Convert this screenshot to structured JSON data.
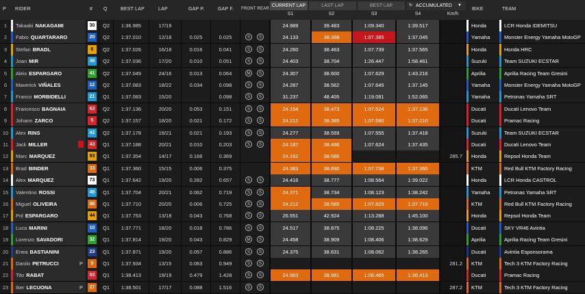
{
  "header": {
    "p": "P",
    "rider": "RIDER",
    "num": "#",
    "q": "Q",
    "best_lap": "BEST LAP",
    "lap": "LAP",
    "gap_p": "GAP P.",
    "gap_f": "GAP F.",
    "tyres": "FRONT REAR",
    "bike": "BIKE",
    "team": "TEAM",
    "speed": "Km/h",
    "tab_current": "CURRENT LAP",
    "tab_last": "LAST LAP",
    "tab_best": "BEST LAP",
    "tab_acc": "ACCUMULATED",
    "s1": "S1",
    "s2": "S2",
    "s3": "S3",
    "s4": "S4"
  },
  "colors": {
    "orange": "#e06a10",
    "red": "#c4161c",
    "gray_sect": "#5a5a5a"
  },
  "rows": [
    {
      "p": "1",
      "rider_first": "Takaaki",
      "rider_last": "NAKAGAMI",
      "num": "30",
      "num_bg": "#ffffff",
      "num_fg": "#000000",
      "q": "Q2",
      "best": "1:36.985",
      "lap": "17/19",
      "gap_p": "",
      "gap_f": "",
      "front": "",
      "rear": "",
      "s1": "24.989",
      "s2": "39.483",
      "s3": "1:09.340",
      "s4": "1:39.517",
      "s1c": "",
      "s2c": "",
      "s3c": "",
      "s4c": "",
      "speed": "",
      "bike": "Honda",
      "team": "LCR Honda IDEMITSU",
      "stripe": "#ffffff",
      "flag": ""
    },
    {
      "p": "2",
      "rider_first": "Fabio",
      "rider_last": "QUARTARARO",
      "num": "20",
      "num_bg": "#1e5fc6",
      "num_fg": "#ffffff",
      "q": "Q2",
      "best": "1:37.010",
      "lap": "12/18",
      "gap_p": "0.025",
      "gap_f": "0.025",
      "front": "S",
      "rear": "S",
      "s1": "24.133",
      "s2": "38.368",
      "s3": "1:07.385",
      "s4": "1:37.045",
      "s1c": "",
      "s2c": "o",
      "s3c": "r",
      "s4c": "",
      "speed": "",
      "bike": "Yamaha",
      "team": "Monster Energy Yamaha MotoGP",
      "stripe": "#1e5fc6",
      "flag": ""
    },
    {
      "p": "3",
      "rider_first": "Stefan",
      "rider_last": "BRADL",
      "num": "6",
      "num_bg": "#e8a200",
      "num_fg": "#000000",
      "q": "Q2",
      "best": "1:37.026",
      "lap": "16/18",
      "gap_p": "0.016",
      "gap_f": "0.041",
      "front": "S",
      "rear": "S",
      "s1": "24.260",
      "s2": "38.463",
      "s3": "1:07.739",
      "s4": "1:37.565",
      "s1c": "",
      "s2c": "",
      "s3c": "",
      "s4c": "",
      "speed": "",
      "bike": "Honda",
      "team": "Honda HRC",
      "stripe": "#e8a200",
      "flag": ""
    },
    {
      "p": "4",
      "rider_first": "Joan",
      "rider_last": "MIR",
      "num": "36",
      "num_bg": "#1f9ad6",
      "num_fg": "#ffffff",
      "q": "Q2",
      "best": "1:37.036",
      "lap": "17/20",
      "gap_p": "0.010",
      "gap_f": "0.051",
      "front": "S",
      "rear": "S",
      "s1": "24.403",
      "s2": "38.704",
      "s3": "1:26.447",
      "s4": "1:58.461",
      "s1c": "",
      "s2c": "",
      "s3c": "",
      "s4c": "",
      "speed": "",
      "bike": "Suzuki",
      "team": "Team SUZUKI ECSTAR",
      "stripe": "#1f9ad6",
      "flag": ""
    },
    {
      "p": "5",
      "rider_first": "Aleix",
      "rider_last": "ESPARGARO",
      "num": "41",
      "num_bg": "#2ca32c",
      "num_fg": "#ffffff",
      "q": "Q2",
      "best": "1:37.049",
      "lap": "24/16",
      "gap_p": "0.013",
      "gap_f": "0.064",
      "front": "M",
      "rear": "S",
      "s1": "24.307",
      "s2": "38.600",
      "s3": "1:07.629",
      "s4": "1:43.216",
      "s1c": "",
      "s2c": "",
      "s3c": "",
      "s4c": "",
      "speed": "",
      "bike": "Aprilia",
      "team": "Aprilia Racing Team Gresini",
      "stripe": "#2ca32c",
      "flag": ""
    },
    {
      "p": "6",
      "rider_first": "Maverick",
      "rider_last": "VIÑALES",
      "num": "12",
      "num_bg": "#1e5fc6",
      "num_fg": "#ffffff",
      "q": "Q2",
      "best": "1:37.083",
      "lap": "18/22",
      "gap_p": "0.034",
      "gap_f": "0.098",
      "front": "S",
      "rear": "S",
      "s1": "24.287",
      "s2": "38.562",
      "s3": "1:07.645",
      "s4": "1:37.145",
      "s1c": "",
      "s2c": "",
      "s3c": "",
      "s4c": "",
      "speed": "",
      "bike": "Yamaha",
      "team": "Monster Energy Yamaha MotoGP",
      "stripe": "#1e5fc6",
      "flag": ""
    },
    {
      "p": "7",
      "rider_first": "Franco",
      "rider_last": "MORBIDELLI",
      "num": "21",
      "num_bg": "#1f9ad6",
      "num_fg": "#ffffff",
      "q": "Q1",
      "best": "1:37.083",
      "lap": "15/20",
      "gap_p": "",
      "gap_f": "0.098",
      "front": "S",
      "rear": "S",
      "s1": "31.237",
      "s2": "48.405",
      "s3": "1:19.081",
      "s4": "1:52.065",
      "s1c": "",
      "s2c": "",
      "s3c": "",
      "s4c": "",
      "speed": "",
      "bike": "Yamaha",
      "team": "Petronas Yamaha SRT",
      "stripe": "#1f9ad6",
      "flag": ""
    },
    {
      "p": "8",
      "rider_first": "Francesco",
      "rider_last": "BAGNAIA",
      "num": "63",
      "num_bg": "#d9242b",
      "num_fg": "#ffffff",
      "q": "Q2",
      "best": "1:37.136",
      "lap": "20/20",
      "gap_p": "0.053",
      "gap_f": "0.151",
      "front": "S",
      "rear": "S",
      "s1": "24.154",
      "s2": "38.473",
      "s3": "1:07.524",
      "s4": "1:37.136",
      "s1c": "o",
      "s2c": "o",
      "s3c": "o",
      "s4c": "o",
      "speed": "",
      "bike": "Ducati",
      "team": "Ducati Lenovo Team",
      "stripe": "#d9242b",
      "flag": ""
    },
    {
      "p": "9",
      "rider_first": "Johann",
      "rider_last": "ZARCO",
      "num": "5",
      "num_bg": "#d9242b",
      "num_fg": "#ffffff",
      "q": "Q2",
      "best": "1:37.157",
      "lap": "18/20",
      "gap_p": "0.021",
      "gap_f": "0.172",
      "front": "S",
      "rear": "S",
      "s1": "24.212",
      "s2": "38.385",
      "s3": "1:07.580",
      "s4": "1:37.210",
      "s1c": "o",
      "s2c": "o",
      "s3c": "o",
      "s4c": "o",
      "speed": "",
      "bike": "Ducati",
      "team": "Pramac Racing",
      "stripe": "#d9242b",
      "flag": ""
    },
    {
      "p": "10",
      "rider_first": "Alex",
      "rider_last": "RINS",
      "num": "42",
      "num_bg": "#1f9ad6",
      "num_fg": "#ffffff",
      "q": "Q2",
      "best": "1:37.178",
      "lap": "19/21",
      "gap_p": "0.021",
      "gap_f": "0.193",
      "front": "S",
      "rear": "S",
      "s1": "24.277",
      "s2": "38.559",
      "s3": "1:07.555",
      "s4": "1:37.418",
      "s1c": "",
      "s2c": "",
      "s3c": "",
      "s4c": "",
      "speed": "",
      "bike": "Suzuki",
      "team": "Team SUZUKI ECSTAR",
      "stripe": "#1f9ad6",
      "flag": ""
    },
    {
      "p": "11",
      "rider_first": "Jack",
      "rider_last": "MILLER",
      "num": "43",
      "num_bg": "#d9242b",
      "num_fg": "#ffffff",
      "q": "Q1",
      "best": "1:37.188",
      "lap": "20/21",
      "gap_p": "0.010",
      "gap_f": "0.203",
      "front": "S",
      "rear": "S",
      "s1": "24.187",
      "s2": "38.486",
      "s3": "1:07.624",
      "s4": "1:37.435",
      "s1c": "o",
      "s2c": "o",
      "s3c": "",
      "s4c": "",
      "speed": "",
      "bike": "Ducati",
      "team": "Ducati Lenovo Team",
      "stripe": "#d9242b",
      "flag": "flag"
    },
    {
      "p": "12",
      "rider_first": "Marc",
      "rider_last": "MARQUEZ",
      "num": "93",
      "num_bg": "#e8a200",
      "num_fg": "#000000",
      "q": "Q1",
      "best": "1:37.354",
      "lap": "14/17",
      "gap_p": "0.166",
      "gap_f": "0.369",
      "front": "",
      "rear": "",
      "s1": "24.162",
      "s2": "38.586",
      "s3": "",
      "s4": "",
      "s1c": "o",
      "s2c": "o",
      "s3c": "",
      "s4c": "",
      "speed": "285.7",
      "bike": "Honda",
      "team": "Repsol Honda Team",
      "stripe": "#e8a200",
      "flag": ""
    },
    {
      "p": "13",
      "rider_first": "Brad",
      "rider_last": "BINDER",
      "num": "33",
      "num_bg": "#e06a10",
      "num_fg": "#ffffff",
      "q": "Q1",
      "best": "1:37.360",
      "lap": "15/15",
      "gap_p": "0.006",
      "gap_f": "0.375",
      "front": "",
      "rear": "",
      "s1": "24.383",
      "s2": "38.690",
      "s3": "1:07.738",
      "s4": "1:37.360",
      "s1c": "o",
      "s2c": "o",
      "s3c": "o",
      "s4c": "o",
      "speed": "",
      "bike": "KTM",
      "team": "Red Bull KTM Factory Racing",
      "stripe": "#e06a10",
      "flag": ""
    },
    {
      "p": "14",
      "rider_first": "Alex",
      "rider_last": "MARQUEZ",
      "num": "73",
      "num_bg": "#ffffff",
      "num_fg": "#000000",
      "q": "Q1",
      "best": "1:37.642",
      "lap": "19/20",
      "gap_p": "0.282",
      "gap_f": "0.657",
      "front": "S",
      "rear": "S",
      "s1": "24.416",
      "s2": "38.777",
      "s3": "1:08.564",
      "s4": "1:39.022",
      "s1c": "",
      "s2c": "",
      "s3c": "",
      "s4c": "",
      "speed": "",
      "bike": "Honda",
      "team": "LCR Honda CASTROL",
      "stripe": "#ffffff",
      "flag": ""
    },
    {
      "p": "15",
      "rider_first": "Valentino",
      "rider_last": "ROSSI",
      "num": "46",
      "num_bg": "#1f9ad6",
      "num_fg": "#ffffff",
      "q": "Q1",
      "best": "1:37.704",
      "lap": "20/21",
      "gap_p": "0.062",
      "gap_f": "0.719",
      "front": "S",
      "rear": "S",
      "s1": "24.371",
      "s2": "38.734",
      "s3": "1:08.123",
      "s4": "1:38.242",
      "s1c": "o",
      "s2c": "",
      "s3c": "",
      "s4c": "",
      "speed": "",
      "bike": "Yamaha",
      "team": "Petronas Yamaha SRT",
      "stripe": "#1f9ad6",
      "flag": ""
    },
    {
      "p": "16",
      "rider_first": "Miguel",
      "rider_last": "OLIVEIRA",
      "num": "88",
      "num_bg": "#e06a10",
      "num_fg": "#ffffff",
      "q": "Q1",
      "best": "1:37.710",
      "lap": "20/20",
      "gap_p": "0.006",
      "gap_f": "0.725",
      "front": "S",
      "rear": "S",
      "s1": "24.212",
      "s2": "38.565",
      "s3": "1:07.829",
      "s4": "1:37.710",
      "s1c": "o",
      "s2c": "o",
      "s3c": "o",
      "s4c": "o",
      "speed": "",
      "bike": "KTM",
      "team": "Red Bull KTM Factory Racing",
      "stripe": "#e06a10",
      "flag": ""
    },
    {
      "p": "17",
      "rider_first": "Pol",
      "rider_last": "ESPARGARO",
      "num": "44",
      "num_bg": "#e8a200",
      "num_fg": "#000000",
      "q": "Q1",
      "best": "1:37.753",
      "lap": "13/18",
      "gap_p": "0.043",
      "gap_f": "0.768",
      "front": "S",
      "rear": "S",
      "s1": "26.551",
      "s2": "42.924",
      "s3": "1:13.288",
      "s4": "1:45.100",
      "s1c": "",
      "s2c": "",
      "s3c": "",
      "s4c": "",
      "speed": "",
      "bike": "Honda",
      "team": "Repsol Honda Team",
      "stripe": "#e8a200",
      "flag": ""
    },
    {
      "p": "18",
      "rider_first": "Luca",
      "rider_last": "MARINI",
      "num": "10",
      "num_bg": "#1e5fc6",
      "num_fg": "#ffffff",
      "q": "Q1",
      "best": "1:37.771",
      "lap": "18/20",
      "gap_p": "0.018",
      "gap_f": "0.786",
      "front": "S",
      "rear": "S",
      "s1": "24.517",
      "s2": "38.875",
      "s3": "1:08.225",
      "s4": "1:38.096",
      "s1c": "",
      "s2c": "",
      "s3c": "",
      "s4c": "",
      "speed": "",
      "bike": "Ducati",
      "team": "SKY VR46 Avintia",
      "stripe": "#1e5fc6",
      "flag": ""
    },
    {
      "p": "19",
      "rider_first": "Lorenzo",
      "rider_last": "SAVADORI",
      "num": "32",
      "num_bg": "#2ca32c",
      "num_fg": "#ffffff",
      "q": "Q1",
      "best": "1:37.814",
      "lap": "19/20",
      "gap_p": "0.043",
      "gap_f": "0.829",
      "front": "M",
      "rear": "S",
      "s1": "24.458",
      "s2": "38.909",
      "s3": "1:08.406",
      "s4": "1:38.629",
      "s1c": "",
      "s2c": "",
      "s3c": "",
      "s4c": "",
      "speed": "",
      "bike": "Aprilia",
      "team": "Aprilia Racing Team Gresini",
      "stripe": "#2ca32c",
      "flag": ""
    },
    {
      "p": "20",
      "rider_first": "Enea",
      "rider_last": "BASTIANINI",
      "num": "23",
      "num_bg": "#1e3c8c",
      "num_fg": "#ffffff",
      "q": "Q1",
      "best": "1:37.871",
      "lap": "19/20",
      "gap_p": "0.057",
      "gap_f": "0.886",
      "front": "S",
      "rear": "S",
      "s1": "24.375",
      "s2": "38.631",
      "s3": "1:08.062",
      "s4": "1:38.265",
      "s1c": "",
      "s2c": "",
      "s3c": "",
      "s4c": "",
      "speed": "",
      "bike": "Ducati",
      "team": "Avintia Esponsorama",
      "stripe": "#1e3c8c",
      "flag": ""
    },
    {
      "p": "21",
      "rider_first": "Danilo",
      "rider_last": "PETRUCCI",
      "num": "9",
      "num_bg": "#e06a10",
      "num_fg": "#ffffff",
      "q": "Q1",
      "best": "1:37.934",
      "lap": "13/15",
      "gap_p": "0.063",
      "gap_f": "0.949",
      "front": "S",
      "rear": "S",
      "s1": "",
      "s2": "",
      "s3": "",
      "s4": "",
      "s1c": "",
      "s2c": "",
      "s3c": "",
      "s4c": "",
      "speed": "281.2",
      "bike": "KTM",
      "team": "Tech 3 KTM Factory Racing",
      "stripe": "#e06a10",
      "flag": "P"
    },
    {
      "p": "22",
      "rider_first": "Tito",
      "rider_last": "RABAT",
      "num": "53",
      "num_bg": "#d9242b",
      "num_fg": "#ffffff",
      "q": "Q1",
      "best": "1:38.413",
      "lap": "19/19",
      "gap_p": "0.479",
      "gap_f": "1.428",
      "front": "S",
      "rear": "S",
      "s1": "24.563",
      "s2": "38.981",
      "s3": "1:08.465",
      "s4": "1:38.413",
      "s1c": "o",
      "s2c": "o",
      "s3c": "o",
      "s4c": "o",
      "speed": "",
      "bike": "Ducati",
      "team": "Pramac Racing",
      "stripe": "#d9242b",
      "flag": ""
    },
    {
      "p": "23",
      "rider_first": "Iker",
      "rider_last": "LECUONA",
      "num": "27",
      "num_bg": "#e06a10",
      "num_fg": "#ffffff",
      "q": "Q1",
      "best": "1:38.501",
      "lap": "17/17",
      "gap_p": "0.088",
      "gap_f": "1.516",
      "front": "S",
      "rear": "S",
      "s1": "",
      "s2": "",
      "s3": "",
      "s4": "",
      "s1c": "",
      "s2c": "",
      "s3c": "",
      "s4c": "",
      "speed": "287.2",
      "bike": "KTM",
      "team": "Tech 3 KTM Factory Racing",
      "stripe": "#e06a10",
      "flag": "P"
    }
  ]
}
